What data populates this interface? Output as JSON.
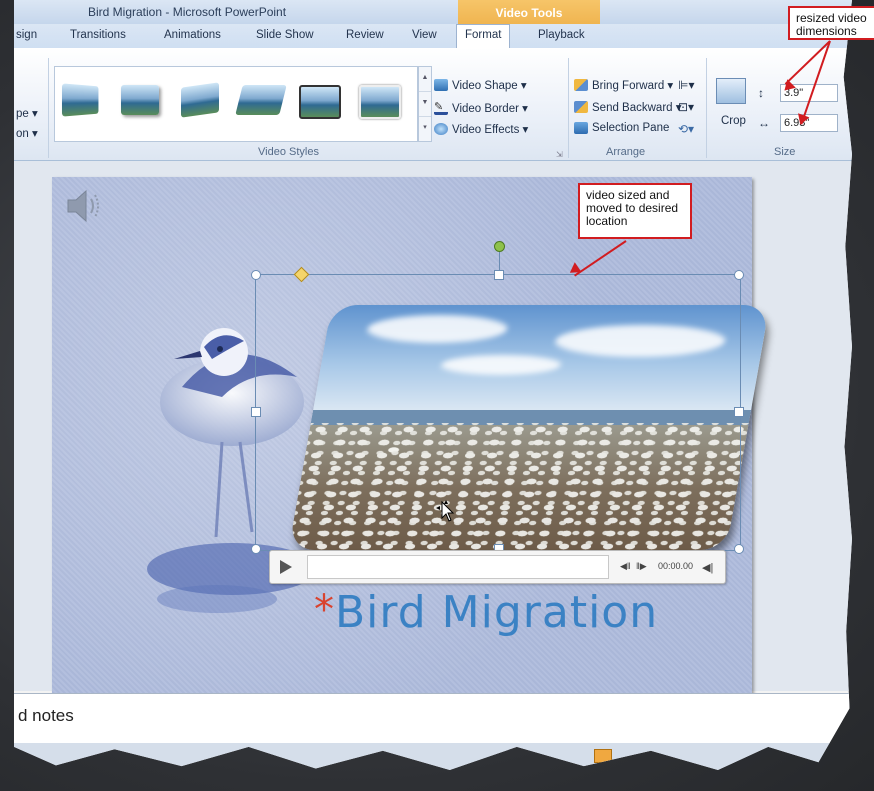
{
  "window": {
    "title": "Bird Migration - Microsoft PowerPoint",
    "context_tab": "Video Tools"
  },
  "ribbon": {
    "tabs": [
      "sign",
      "Transitions",
      "Animations",
      "Slide Show",
      "Review",
      "View",
      "Format",
      "Playback"
    ],
    "active_tab": "Format",
    "left_cut_labels": [
      "pe ▾",
      "on ▾"
    ],
    "video_styles": {
      "commands": [
        "Video Shape ▾",
        "Video Border ▾",
        "Video Effects ▾"
      ],
      "group_label": "Video Styles"
    },
    "arrange": {
      "commands": [
        "Bring Forward ▾",
        "Send Backward ▾",
        "Selection Pane"
      ],
      "group_label": "Arrange"
    },
    "size": {
      "crop_label": "Crop",
      "height_value": "3.9\"",
      "width_value": "6.93\"",
      "group_label": "Size"
    }
  },
  "player": {
    "time": "00:00.00"
  },
  "slide": {
    "title_marker": "*",
    "title": "Bird Migration"
  },
  "notes": {
    "placeholder": "d notes"
  },
  "callouts": {
    "dimensions": "resized video dimensions",
    "location": "video sized and moved to desired location"
  },
  "colors": {
    "callout_border": "#d11c20",
    "title_text": "#3b82c4",
    "context_tab": "#eaa437"
  }
}
